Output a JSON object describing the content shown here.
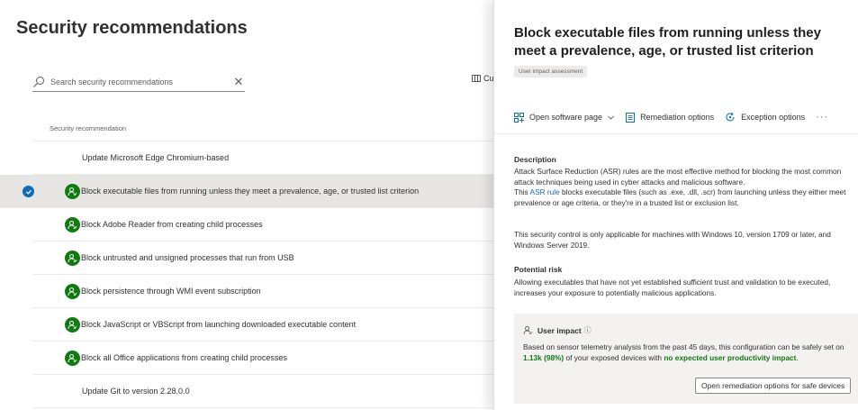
{
  "left": {
    "title": "Security recommendations",
    "search_placeholder": "Search security recommendations",
    "columns_label": "Cu",
    "column_header": "Security recommendation",
    "rows": [
      {
        "label": "Update Microsoft Edge Chromium-based",
        "badge": false,
        "selected": false
      },
      {
        "label": "Block executable files from running unless they meet a prevalence, age, or trusted list criterion",
        "badge": true,
        "selected": true
      },
      {
        "label": "Block Adobe Reader from creating child processes",
        "badge": true,
        "selected": false
      },
      {
        "label": "Block untrusted and unsigned processes that run from USB",
        "badge": true,
        "selected": false
      },
      {
        "label": "Block persistence through WMI event subscription",
        "badge": true,
        "selected": false
      },
      {
        "label": "Block JavaScript or VBScript from launching downloaded executable content",
        "badge": true,
        "selected": false
      },
      {
        "label": "Block all Office applications from creating child processes",
        "badge": true,
        "selected": false
      },
      {
        "label": "Update Git to version 2.28.0.0",
        "badge": false,
        "selected": false
      }
    ]
  },
  "panel": {
    "title": "Block executable files from running unless they meet a prevalence, age, or trusted list criterion",
    "tag": "User impact assessment",
    "toolbar": {
      "open_software": "Open software page",
      "remediation": "Remediation options",
      "exception": "Exception options",
      "more": "···"
    },
    "description_head": "Description",
    "description_p1": "Attack Surface Reduction (ASR) rules are the most effective method for blocking the most common attack techniques being used in cyber attacks and malicious software.",
    "description_p2_pre": "This ",
    "description_p2_link": "ASR rule",
    "description_p2_post": " blocks executable files (such as .exe, .dll, .scr) from launching unless they either meet prevalence or age criteria, or they're in a trusted list or exclusion list.",
    "description_p3": "This security control is only applicable for machines with Windows 10, version 1709 or later, and Windows Server 2019.",
    "risk_head": "Potential risk",
    "risk_text": "Allowing executables that have not yet established sufficient trust and validation to be executed, increases your exposure to potentially malicious applications.",
    "impact": {
      "head": "User impact",
      "text_pre": "Based on sensor telemetry analysis from the past 45 days, this configuration can be safely set on ",
      "devices": "1.13k (98%)",
      "text_mid": " of your exposed devices with ",
      "no_impact": "no expected user productivity impact",
      "text_end": ".",
      "button": "Open remediation options for safe devices"
    }
  },
  "colors": {
    "accent": "#0f6cbd",
    "green": "#107c10",
    "selected_row": "#e8e6e5"
  },
  "icons": [
    "search-icon",
    "clear-icon",
    "columns-icon",
    "select-check-icon",
    "user-impact-icon",
    "apps-icon",
    "chevron-down-icon",
    "remediation-icon",
    "exception-icon",
    "more-icon",
    "info-icon"
  ]
}
